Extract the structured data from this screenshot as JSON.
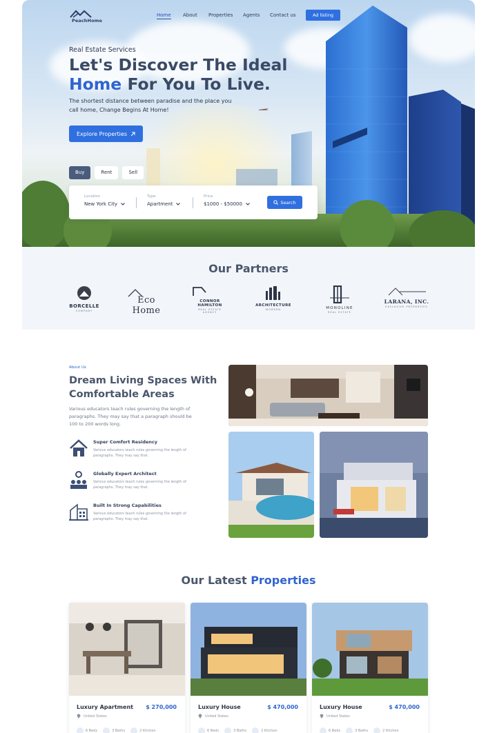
{
  "nav": {
    "brand": "PeachHome",
    "links": [
      "Home",
      "About",
      "Properties",
      "Agents",
      "Contact us"
    ],
    "active": "Home",
    "cta": "Ad listing"
  },
  "hero": {
    "kicker": "Real Estate Services",
    "title_line1": "Let's Discover The Ideal",
    "title_accent": "Home",
    "title_rest": "For You To Live.",
    "description": "The shortest distance between paradise and the place you call home, Change Begins At Home!",
    "explore_label": "Explore Properties",
    "tabs": [
      "Buy",
      "Rent",
      "Sell"
    ],
    "active_tab": "Buy"
  },
  "search": {
    "location_label": "Location",
    "location_value": "New York City",
    "type_label": "Type",
    "type_value": "Apartment",
    "price_label": "Price",
    "price_value": "$1000 - $50000",
    "search_label": "Search"
  },
  "partners": {
    "title": "Our Partners",
    "logos": [
      {
        "name": "BORCELLE",
        "sub": "COMPANY"
      },
      {
        "name": "Eco Home",
        "sub": ""
      },
      {
        "name": "CONNOR HAMILTON",
        "sub": "REAL ESTATE AGENCY"
      },
      {
        "name": "ARCHITECTURE",
        "sub": "MODERN"
      },
      {
        "name": "MONOLINE",
        "sub": "REAL ESTATE"
      },
      {
        "name": "LARANA, INC.",
        "sub": "EXCLUSIVE PROPERTIES"
      }
    ]
  },
  "about": {
    "kicker": "About Us",
    "title": "Dream Living Spaces With Comfortable Areas",
    "description": "Various educators teach rules governing the length of paragraphs. They may say that a paragraph should be 100 to 200 words long.",
    "features": [
      {
        "title": "Super Comfort Residency",
        "desc": "Various educators teach rules governing the length of paragraphs. They may say that.",
        "icon": "house-icon"
      },
      {
        "title": "Globally Expert Architect",
        "desc": "Various educators teach rules governing the length of paragraphs. They may say that.",
        "icon": "team-icon"
      },
      {
        "title": "Built In Strong Capabilities",
        "desc": "Various educators teach rules governing the length of paragraphs. They may say that.",
        "icon": "building-icon"
      }
    ]
  },
  "properties": {
    "title": "Our Latest",
    "title_accent": "Properties",
    "items": [
      {
        "name": "Luxury Apartment",
        "price": "$ 270,000",
        "location": "United States",
        "beds": "6 Beds",
        "baths": "3 Baths",
        "kitchen": "2 Kitchen"
      },
      {
        "name": "Luxury House",
        "price": "$ 470,000",
        "location": "United States",
        "beds": "6 Beds",
        "baths": "3 Baths",
        "kitchen": "2 Kitchen"
      },
      {
        "name": "Luxury House",
        "price": "$ 470,000",
        "location": "United States",
        "beds": "6 Beds",
        "baths": "3 Baths",
        "kitchen": "2 Kitchen"
      }
    ]
  },
  "colors": {
    "accent": "#2f6fe0",
    "heading": "#4a566b",
    "partners_bg": "#f2f6fb"
  }
}
